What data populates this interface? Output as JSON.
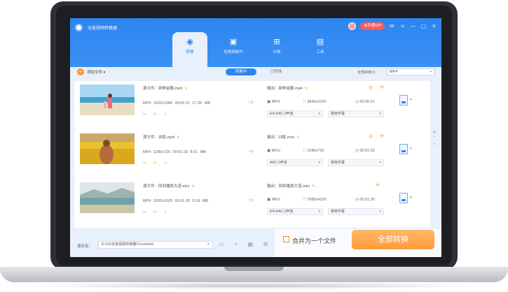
{
  "app": {
    "title": "全能视频转换器",
    "vip_label": "♛开通VIP",
    "window_controls": [
      "✉",
      "≡",
      "—",
      "▢",
      "✕"
    ]
  },
  "tabs": [
    {
      "label": "转换",
      "icon": "convert-icon",
      "glyph": "◉",
      "active": true
    },
    {
      "label": "短视频制作",
      "icon": "video-edit-icon",
      "glyph": "▣",
      "active": false
    },
    {
      "label": "分屏",
      "icon": "split-screen-icon",
      "glyph": "⊞",
      "active": false
    },
    {
      "label": "工具",
      "icon": "toolbox-icon",
      "glyph": "▤",
      "active": false
    }
  ],
  "toolbar": {
    "add_label": "添加文件 ▾",
    "seg_converting": "转换中",
    "seg_converted": "已转换",
    "convert_all_label": "全部转换为：",
    "format_value": "MP4"
  },
  "rows": [
    {
      "source": "源文件：新鲜金鹏.mp4",
      "src_meta": "MP4  1920x1080  00:05:21  27.35 MB",
      "tools": "✂ ✄ ☺",
      "output": "输出：新鲜金鹏.mp4",
      "out_format": "▣ MP4",
      "out_res": "⛶ 3840x2160",
      "out_dur": "◷ 00:05:21",
      "audio": "EN-AAC-2声道",
      "subtitle": "禁用字幕",
      "icons": "◎ ✢",
      "scene": "beach"
    },
    {
      "source": "源文件：训练.mp4",
      "src_meta": "MP4  1280x720  00:01:33  8.01 MB",
      "tools": "✂ ✄ ☺",
      "output": "输出：训练.mov",
      "out_format": "▣ MOV",
      "out_res": "⛶ 1280x720",
      "out_dur": "◷ 00:01:33",
      "audio": "AAC-2声道",
      "subtitle": "禁用字幕",
      "icons": "◎ ✢",
      "scene": "field"
    },
    {
      "source": "源文件：回到播放大道.mkv",
      "src_meta": "MP4  1920x1020  00:01:30  9.18 MB",
      "tools": "✂ ✄ ☺",
      "output": "输出：回到播放大道.mkv",
      "out_format": "▣ MKV",
      "out_res": "⛶ 7680x4320",
      "out_dur": "◷ 00:01:30",
      "audio": "EN-AAC-2声道",
      "subtitle": "禁用字幕",
      "icons": "✢",
      "scene": "sea"
    }
  ],
  "bottom": {
    "save_label": "保存至：",
    "save_path": "E:\\XX\\全能视频转换器\\Converted",
    "merge_label": "合并为一个文件",
    "convert_all_button": "全部转换"
  },
  "colors": {
    "accent": "#2d85f0",
    "orange": "#f59a2a",
    "button": "#ff9a3c"
  }
}
